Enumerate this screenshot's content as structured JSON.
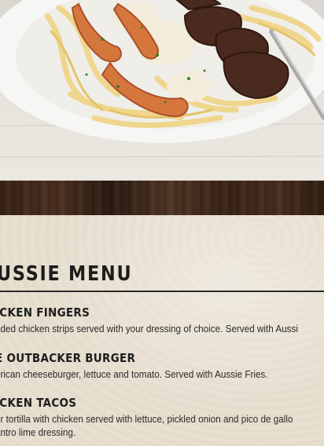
{
  "menu": {
    "title": "USSIE MENU",
    "items": [
      {
        "name": "ICKEN FINGERS",
        "description": "aded chicken strips served with your dressing of choice. Served with Aussi"
      },
      {
        "name": "E OUTBACKER BURGER",
        "description": "erican cheeseburger, lettuce and tomato. Served with Aussie Fries."
      },
      {
        "name": "ICKEN TACOS",
        "description": "ur tortilla with chicken served with lettuce, pickled onion and pico de gallo",
        "description_line2": "antro lime dressing."
      }
    ]
  },
  "images": {
    "hero": "shrimp-and-steak-fettuccine-photo",
    "divider": "wood-texture-band"
  },
  "colors": {
    "paper": "#e8e0d1",
    "wood": "#3a2418",
    "text": "#1c1c1c"
  }
}
